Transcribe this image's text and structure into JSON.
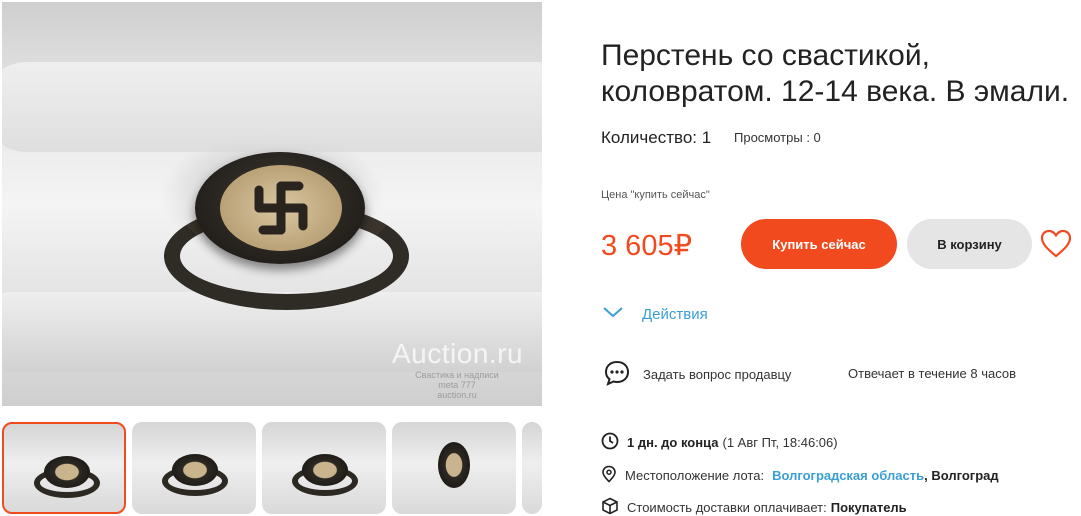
{
  "gallery": {
    "watermark": "Auction.ru",
    "watermark_small": [
      "Свастика и надписи",
      "meta 777",
      "auction.ru"
    ],
    "thumbnails": [
      "thumb-1",
      "thumb-2",
      "thumb-3",
      "thumb-4"
    ]
  },
  "lot": {
    "title": "Перстень со свастикой, коловратом. 12-14 века. В эмали.",
    "quantity": "Количество: 1",
    "views": "Просмотры : 0"
  },
  "purchase": {
    "price_label": "Цена \"купить сейчас\"",
    "price": "3 605₽",
    "buy_now_label": "Купить сейчас",
    "cart_label": "В корзину"
  },
  "actions": {
    "label": "Действия"
  },
  "seller": {
    "ask_label": "Задать вопрос продавцу",
    "reply_time": "Отвечает в течение 8 часов"
  },
  "details": {
    "time_left": "1 дн. до конца",
    "end_date": "(1 Авг Пт, 18:46:06)",
    "location_label": "Местоположение лота:",
    "region": "Волгоградская область",
    "city": "Волгоград",
    "delivery_label": "Стоимость доставки оплачивает:",
    "delivery_payer": "Покупатель"
  },
  "colors": {
    "accent": "#f24a1f",
    "link": "#3b9fd6",
    "secondary_button": "#e5e5e5"
  }
}
